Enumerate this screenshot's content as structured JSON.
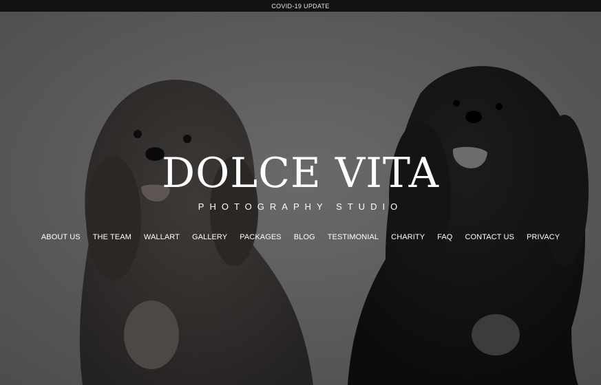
{
  "topbar": {
    "label": "COVID-19 UPDATE"
  },
  "brand": {
    "title": "DOLCE VITA",
    "subtitle": "PHOTOGRAPHY STUDIO"
  },
  "nav": {
    "items": [
      {
        "label": "ABOUT US"
      },
      {
        "label": "THE TEAM"
      },
      {
        "label": "WALLART"
      },
      {
        "label": "GALLERY"
      },
      {
        "label": "PACKAGES"
      },
      {
        "label": "BLOG"
      },
      {
        "label": "TESTIMONIAL"
      },
      {
        "label": "CHARITY"
      },
      {
        "label": "FAQ"
      },
      {
        "label": "CONTACT US"
      },
      {
        "label": "PRIVACY"
      }
    ]
  },
  "colors": {
    "topbar_bg": "#111111",
    "text": "#ffffff",
    "hero_bg": "#5a5a5a"
  }
}
